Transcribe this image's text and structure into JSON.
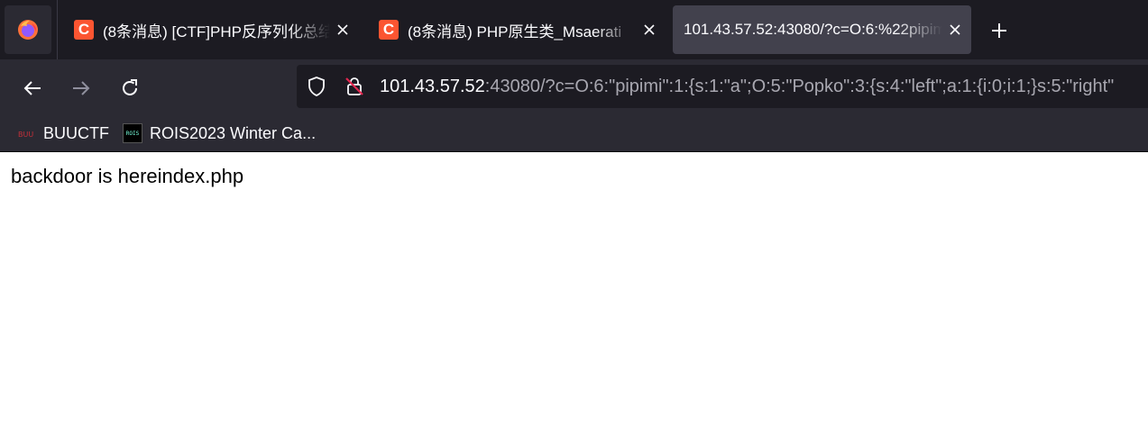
{
  "browser": {
    "firefox_button_icon": "firefox-logo-icon",
    "tabs": [
      {
        "title": "(8条消息) [CTF]PHP反序列化总结",
        "favicon": "csdn-c-icon",
        "active": false
      },
      {
        "title": "(8条消息) PHP原生类_Msaerati",
        "favicon": "csdn-c-icon",
        "active": false
      },
      {
        "title": "101.43.57.52:43080/?c=O:6:%22pipimi",
        "favicon": "",
        "active": true
      }
    ],
    "favicon_letter": "C",
    "new_tab_icon": "plus-icon"
  },
  "navbar": {
    "back_icon": "back-arrow-icon",
    "forward_icon": "forward-arrow-icon",
    "reload_icon": "reload-icon",
    "url_host": "101.43.57.52",
    "url_rest": ":43080/?c=O:6:\"pipimi\":1:{s:1:\"a\";O:5:\"Popko\":3:{s:4:\"left\";a:1:{i:0;i:1;}s:5:\"right\""
  },
  "bookmarks": [
    {
      "label": "BUUCTF",
      "icon": "buuctf-icon"
    },
    {
      "label": "ROIS2023 Winter Ca...",
      "icon": "rois-icon",
      "icon_text": "ROIS"
    }
  ],
  "page": {
    "body_text": "backdoor is hereindex.php"
  },
  "colors": {
    "tabstrip_bg": "#1c1b22",
    "toolbar_bg": "#2b2a33",
    "active_tab_bg": "#42414d",
    "csdn_red": "#fc5531"
  }
}
